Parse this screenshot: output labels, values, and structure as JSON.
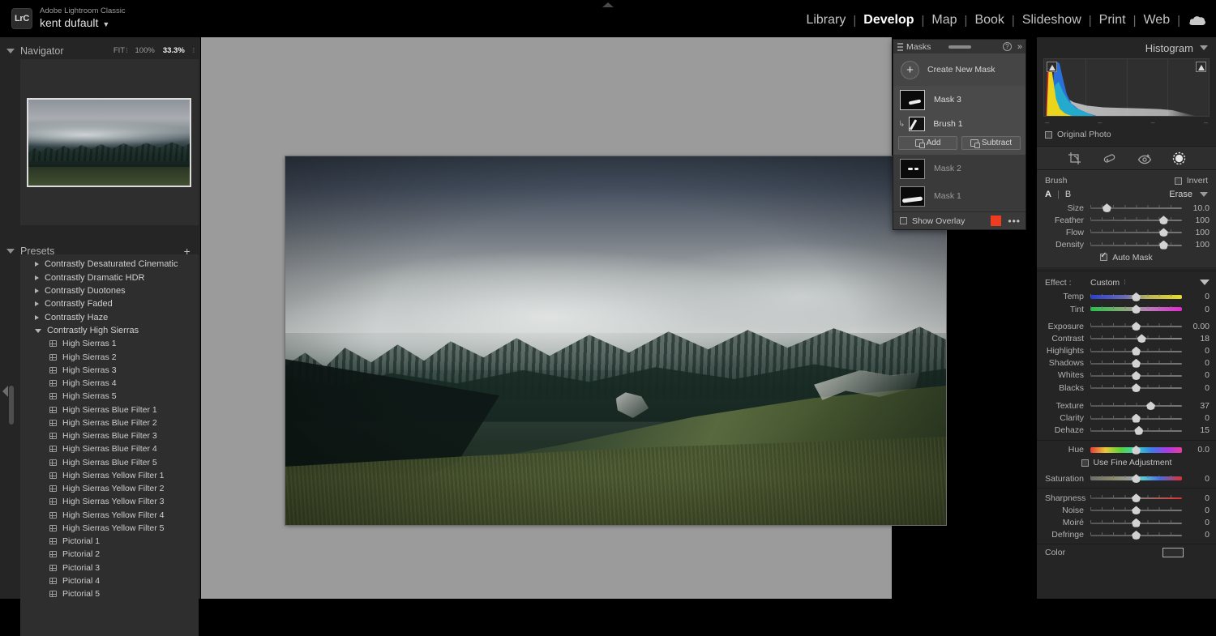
{
  "app": {
    "logo_text": "LrC",
    "product_name": "Adobe Lightroom Classic",
    "user_name": "kent dufault",
    "user_caret": "▼"
  },
  "modules": {
    "items": [
      {
        "label": "Library",
        "active": false
      },
      {
        "label": "Develop",
        "active": true
      },
      {
        "label": "Map",
        "active": false
      },
      {
        "label": "Book",
        "active": false
      },
      {
        "label": "Slideshow",
        "active": false
      },
      {
        "label": "Print",
        "active": false
      },
      {
        "label": "Web",
        "active": false
      }
    ],
    "separator": "|",
    "cloud_icon": "cloud-icon"
  },
  "navigator": {
    "title": "Navigator",
    "fit_label": "FIT",
    "zoom_100": "100%",
    "zoom_current": "33.3%"
  },
  "presets": {
    "title": "Presets",
    "add_icon": "plus-icon",
    "groups": [
      {
        "label": "Contrastly Desaturated Cinematic",
        "open": false
      },
      {
        "label": "Contrastly Dramatic HDR",
        "open": false
      },
      {
        "label": "Contrastly Duotones",
        "open": false
      },
      {
        "label": "Contrastly Faded",
        "open": false
      },
      {
        "label": "Contrastly Haze",
        "open": false
      },
      {
        "label": "Contrastly High Sierras",
        "open": true
      }
    ],
    "items": [
      "High Sierras 1",
      "High Sierras 2",
      "High Sierras 3",
      "High Sierras 4",
      "High Sierras 5",
      "High Sierras Blue Filter 1",
      "High Sierras Blue Filter 2",
      "High Sierras Blue Filter 3",
      "High Sierras Blue Filter 4",
      "High Sierras Blue Filter 5",
      "High Sierras Yellow Filter 1",
      "High Sierras Yellow Filter 2",
      "High Sierras Yellow Filter 3",
      "High Sierras Yellow Filter 4",
      "High Sierras Yellow Filter 5",
      "Pictorial 1",
      "Pictorial 2",
      "Pictorial 3",
      "Pictorial 4",
      "Pictorial 5"
    ]
  },
  "masks": {
    "title": "Masks",
    "help_icon": "question-icon",
    "collapse_icon": "chevron-double-right-icon",
    "create_label": "Create New Mask",
    "add_label": "Add",
    "subtract_label": "Subtract",
    "entries": [
      {
        "label": "Mask 3",
        "selected": true
      },
      {
        "label": "Brush 1",
        "selected": true,
        "sub": true
      },
      {
        "label": "Mask 2",
        "selected": false
      },
      {
        "label": "Mask 1",
        "selected": false
      }
    ],
    "show_overlay_label": "Show Overlay",
    "show_overlay_checked": false,
    "overlay_color": "#ef3b20",
    "more_icon": "ellipsis-icon"
  },
  "histogram": {
    "title": "Histogram",
    "original_photo_label": "Original Photo",
    "original_photo_checked": false
  },
  "tools": [
    {
      "name": "crop-overlay-icon",
      "active": false
    },
    {
      "name": "spot-removal-icon",
      "active": false
    },
    {
      "name": "red-eye-icon",
      "active": false
    },
    {
      "name": "masking-icon",
      "active": true
    }
  ],
  "brush": {
    "title": "Brush",
    "invert_label": "Invert",
    "invert_checked": false,
    "a_label": "A",
    "b_label": "B",
    "erase_label": "Erase",
    "sliders": [
      {
        "label": "Size",
        "value": "10.0",
        "pos": 18
      },
      {
        "label": "Feather",
        "value": "100",
        "pos": 80
      },
      {
        "label": "Flow",
        "value": "100",
        "pos": 80
      },
      {
        "label": "Density",
        "value": "100",
        "pos": 80
      }
    ],
    "auto_mask_label": "Auto Mask",
    "auto_mask_checked": true
  },
  "effect": {
    "key_label": "Effect :",
    "value_label": "Custom",
    "group_white_balance": [
      {
        "label": "Temp",
        "value": "0",
        "pos": 50,
        "grad": "grad-temp"
      },
      {
        "label": "Tint",
        "value": "0",
        "pos": 50,
        "grad": "grad-tint"
      }
    ],
    "group_tone": [
      {
        "label": "Exposure",
        "value": "0.00",
        "pos": 50,
        "grad": ""
      },
      {
        "label": "Contrast",
        "value": "18",
        "pos": 56,
        "grad": "bright"
      },
      {
        "label": "Highlights",
        "value": "0",
        "pos": 50,
        "grad": ""
      },
      {
        "label": "Shadows",
        "value": "0",
        "pos": 50,
        "grad": ""
      },
      {
        "label": "Whites",
        "value": "0",
        "pos": 50,
        "grad": ""
      },
      {
        "label": "Blacks",
        "value": "0",
        "pos": 50,
        "grad": ""
      }
    ],
    "group_presence": [
      {
        "label": "Texture",
        "value": "37",
        "pos": 66,
        "grad": ""
      },
      {
        "label": "Clarity",
        "value": "0",
        "pos": 50,
        "grad": ""
      },
      {
        "label": "Dehaze",
        "value": "15",
        "pos": 53,
        "grad": ""
      }
    ],
    "group_hue": [
      {
        "label": "Hue",
        "value": "0.0",
        "pos": 50,
        "grad": "grad-hue"
      }
    ],
    "fine_adjust_label": "Use Fine Adjustment",
    "fine_adjust_checked": false,
    "group_color": [
      {
        "label": "Saturation",
        "value": "0",
        "pos": 50,
        "grad": "grad-sat"
      }
    ],
    "group_detail": [
      {
        "label": "Sharpness",
        "value": "0",
        "pos": 50,
        "grad": "grad-sharp"
      },
      {
        "label": "Noise",
        "value": "0",
        "pos": 50,
        "grad": ""
      },
      {
        "label": "Moiré",
        "value": "0",
        "pos": 50,
        "grad": ""
      },
      {
        "label": "Defringe",
        "value": "0",
        "pos": 50,
        "grad": ""
      }
    ],
    "color_label": "Color"
  }
}
